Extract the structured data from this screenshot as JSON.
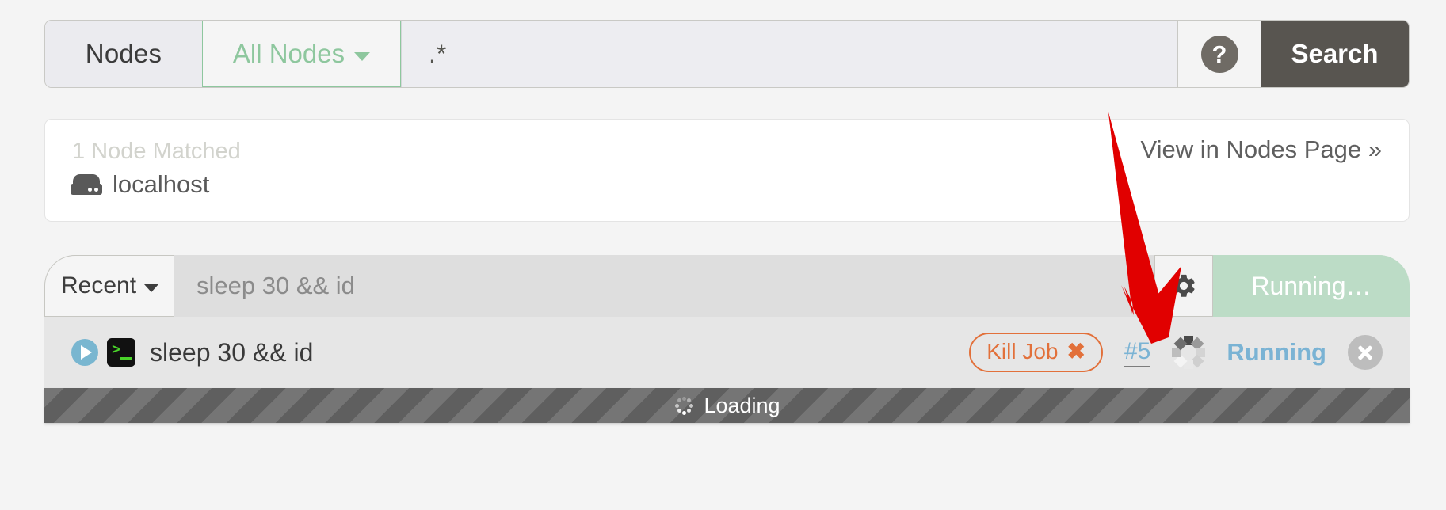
{
  "search_bar": {
    "scope_label": "Nodes",
    "node_filter": "All Nodes",
    "query_value": ".*",
    "query_placeholder": "",
    "help_icon": "question-mark-icon",
    "search_button": "Search"
  },
  "node_panel": {
    "matched_text": "1 Node Matched",
    "node_icon": "hdd-icon",
    "node_name": "localhost",
    "view_link": "View in Nodes Page »"
  },
  "command_bar": {
    "recent_label": "Recent",
    "command_value": "sleep 30 && id",
    "gear_icon": "gear-icon",
    "run_button_label": "Running…"
  },
  "job_row": {
    "play_icon": "play-icon",
    "terminal_icon": "terminal-icon",
    "command": "sleep 30 && id",
    "kill_label": "Kill Job",
    "kill_icon": "x-icon",
    "job_id": "#5",
    "spinner_icon": "square-spinner-icon",
    "status": "Running",
    "close_icon": "close-circle-icon"
  },
  "loading_bar": {
    "label": "Loading",
    "spinner_icon": "dot-spinner-icon"
  },
  "annotation": {
    "arrow_color": "#e10000",
    "points_at": "#5"
  },
  "colors": {
    "accent_green": "#8ec79e",
    "link_blue": "#7ab3d4",
    "kill_orange": "#e2703a",
    "search_dark": "#585550",
    "annotation_red": "#e10000"
  }
}
